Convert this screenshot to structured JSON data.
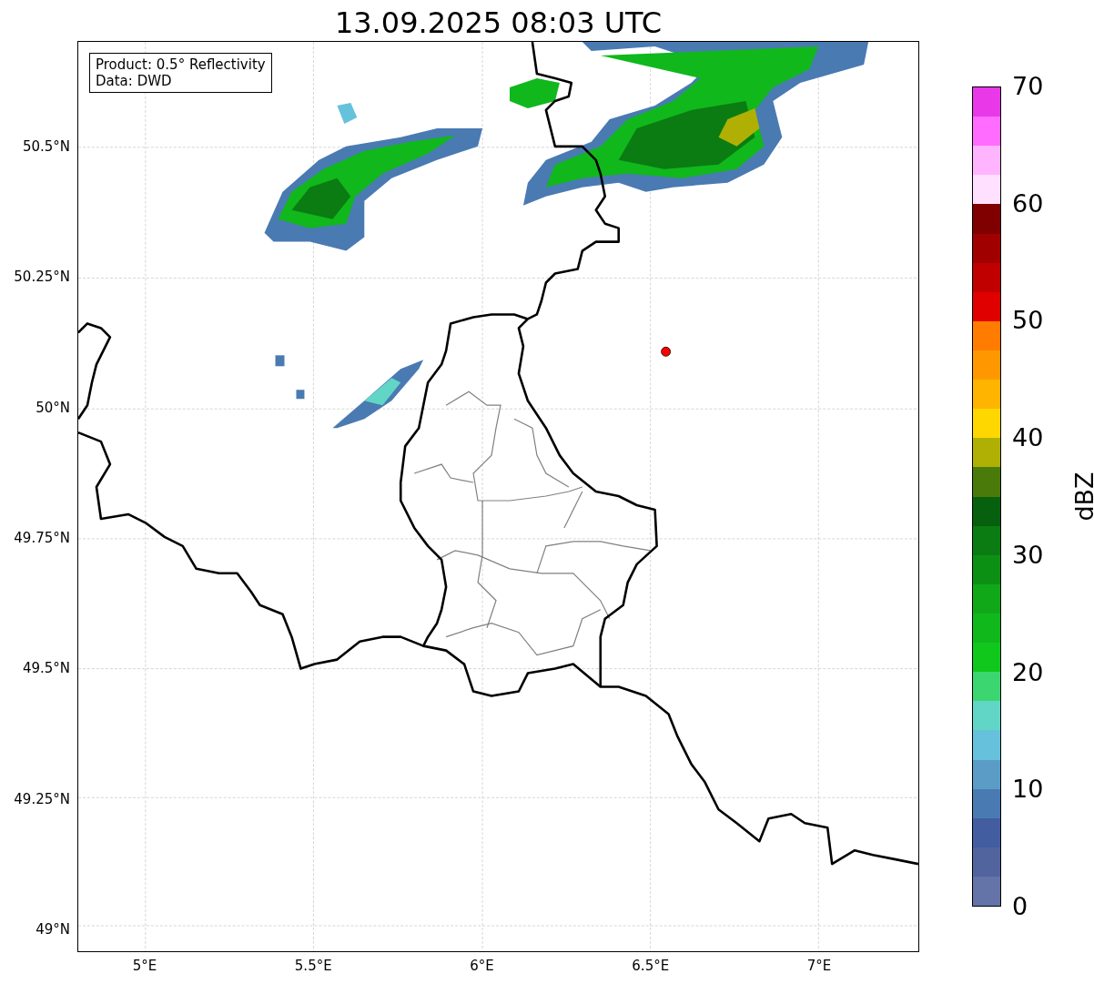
{
  "title": "13.09.2025 08:03 UTC",
  "annotation": [
    "Product: 0.5° Reflectivity",
    "Data: DWD"
  ],
  "map": {
    "y_ticks": [
      "50.5°N",
      "50.25°N",
      "50°N",
      "49.75°N",
      "49.5°N",
      "49.25°N",
      "49°N"
    ],
    "x_ticks": [
      "5°E",
      "5.5°E",
      "6°E",
      "6.5°E",
      "7°E"
    ]
  },
  "colorbar": {
    "label": "dBZ",
    "ticks": [
      "70",
      "60",
      "50",
      "40",
      "30",
      "20",
      "10",
      "0"
    ],
    "bands": [
      {
        "color": "#e838e8"
      },
      {
        "color": "#ff6cff"
      },
      {
        "color": "#ffb4ff"
      },
      {
        "color": "#ffe0ff"
      },
      {
        "color": "#800000"
      },
      {
        "color": "#a00000"
      },
      {
        "color": "#c00000"
      },
      {
        "color": "#e00000"
      },
      {
        "color": "#ff7c00"
      },
      {
        "color": "#ff9800"
      },
      {
        "color": "#ffb400"
      },
      {
        "color": "#ffd700"
      },
      {
        "color": "#b0b004"
      },
      {
        "color": "#4a7a0a"
      },
      {
        "color": "#06600e"
      },
      {
        "color": "#0a7c12"
      },
      {
        "color": "#0c9014"
      },
      {
        "color": "#10a818"
      },
      {
        "color": "#10b81c"
      },
      {
        "color": "#10c81c"
      },
      {
        "color": "#3cd670"
      },
      {
        "color": "#62d6c6"
      },
      {
        "color": "#66c1dc"
      },
      {
        "color": "#5a9cc6"
      },
      {
        "color": "#4a7ab2"
      },
      {
        "color": "#425da0"
      },
      {
        "color": "#52649e"
      },
      {
        "color": "#6473a8"
      }
    ]
  }
}
